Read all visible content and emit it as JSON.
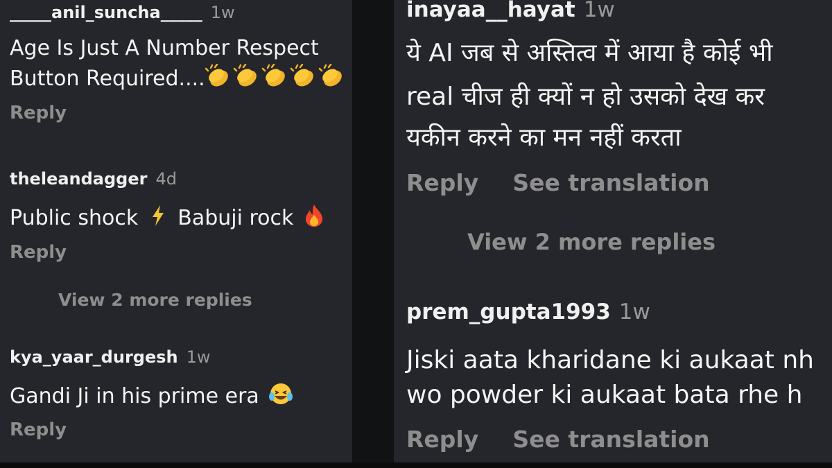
{
  "left": {
    "comments": [
      {
        "username": "_____anil_suncha_____",
        "time": "1w",
        "text_line1": "Age Is Just A Number Respect",
        "text_line2": "Button Required....",
        "emoji": "clapping-hands x5",
        "reply": "Reply"
      },
      {
        "username": "theleandagger",
        "time": "4d",
        "text_part1": "Public shock",
        "emoji1": "lightning",
        "text_part2": "Babuji rock",
        "emoji2": "fire",
        "reply": "Reply",
        "view_more": "View 2 more replies"
      },
      {
        "username": "kya_yaar_durgesh",
        "time": "1w",
        "text": "Gandi Ji in his prime era",
        "emoji": "laughing-tears",
        "reply": "Reply"
      }
    ]
  },
  "right": {
    "comments": [
      {
        "username": "inayaa__hayat",
        "time": "1w",
        "text_line1": "ये AI जब से अस्तित्व में आया है कोई भी",
        "text_line2": "real चीज ही क्यों न हो उसको देख कर",
        "text_line3": "यकीन करने का मन नहीं करता",
        "reply": "Reply",
        "translation": "See translation",
        "view_more": "View 2 more replies"
      },
      {
        "username": "prem_gupta1993",
        "time": "1w",
        "text_line1": "Jiski aata kharidane ki aukaat nh",
        "text_line2": "wo powder ki aukaat bata rhe h",
        "reply": "Reply",
        "translation": "See translation"
      }
    ]
  },
  "colors": {
    "panel_bg": "#25262b",
    "background": "#111214",
    "secondary_text": "#8e8e8e"
  }
}
